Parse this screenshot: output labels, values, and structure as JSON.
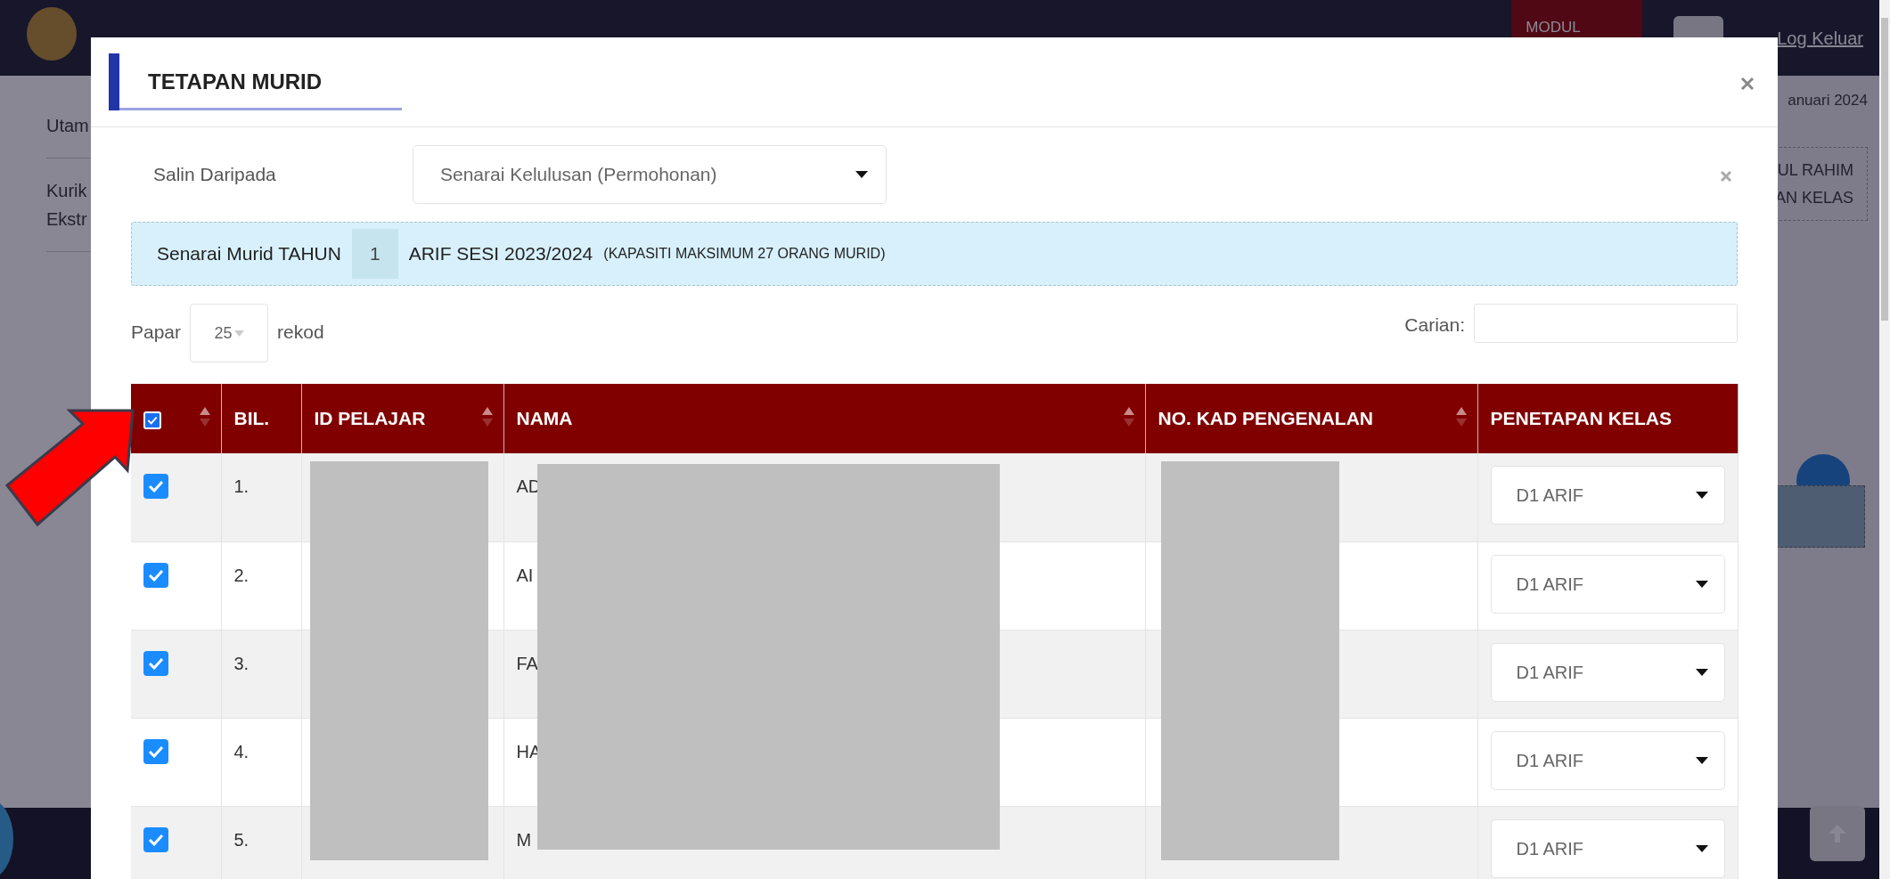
{
  "background_page": {
    "module_button": "MODUL",
    "logout": "Log Keluar",
    "date_text": "anuari 2024",
    "sidebar_items": [
      {
        "lines": [
          "Utam"
        ]
      },
      {
        "lines": [
          "Kurik",
          "Ekstr"
        ]
      }
    ],
    "teacher_box": [
      "UL RAHIM",
      "AN KELAS"
    ]
  },
  "modal": {
    "title": "TETAPAN MURID",
    "copy_from": {
      "label": "Salin Daripada",
      "value": "Senarai Kelulusan (Permohonan)"
    },
    "info": {
      "prefix": "Senarai Murid TAHUN",
      "year": "1",
      "suffix": "ARIF SESI 2023/2024",
      "note": "(KAPASITI MAKSIMUM 27 ORANG MURID)"
    },
    "length": {
      "before": "Papar",
      "value": "25",
      "after": "rekod"
    },
    "search": {
      "label": "Carian:"
    },
    "table": {
      "columns": [
        {
          "kind": "checkbox",
          "checked": true,
          "sortable": true
        },
        {
          "kind": "text",
          "label": "BIL.",
          "sortable": false
        },
        {
          "kind": "text",
          "label": "ID PELAJAR",
          "sortable": true
        },
        {
          "kind": "text",
          "label": "NAMA",
          "sortable": true
        },
        {
          "kind": "text",
          "label": "NO. KAD PENGENALAN",
          "sortable": true
        },
        {
          "kind": "text",
          "label": "PENETAPAN KELAS",
          "sortable": false
        }
      ],
      "rows": [
        {
          "checked": true,
          "number": "1.",
          "name": "AD",
          "class": "D1 ARIF"
        },
        {
          "checked": true,
          "number": "2.",
          "name": "AI",
          "class": "D1 ARIF"
        },
        {
          "checked": true,
          "number": "3.",
          "name": "FA",
          "class": "D1 ARIF"
        },
        {
          "checked": true,
          "number": "4.",
          "name": "HA",
          "class": "D1 ARIF"
        },
        {
          "checked": true,
          "number": "5.",
          "name": "M",
          "class": "D1 ARIF"
        }
      ]
    }
  }
}
